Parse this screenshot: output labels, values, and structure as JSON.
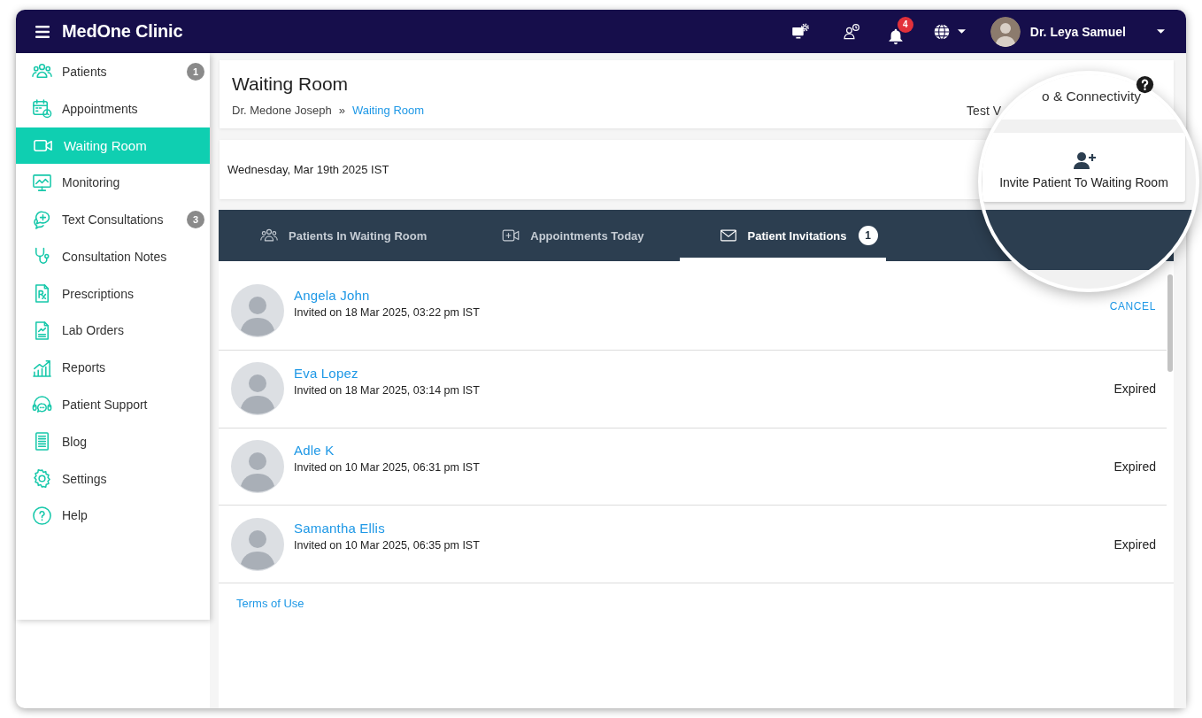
{
  "topbar": {
    "title": "MedOne Clinic",
    "notification_count": "4",
    "user_name": "Dr. Leya Samuel"
  },
  "sidebar": {
    "items": [
      {
        "label": "Patients",
        "badge": "1",
        "selected": false
      },
      {
        "label": "Appointments",
        "selected": false
      },
      {
        "label": "Waiting Room",
        "selected": true
      },
      {
        "label": "Monitoring",
        "selected": false
      },
      {
        "label": "Text Consultations",
        "badge": "3",
        "selected": false
      },
      {
        "label": "Consultation Notes",
        "selected": false
      },
      {
        "label": "Prescriptions",
        "selected": false
      },
      {
        "label": "Lab Orders",
        "selected": false
      },
      {
        "label": "Reports",
        "selected": false
      },
      {
        "label": "Patient Support",
        "selected": false
      },
      {
        "label": "Blog",
        "selected": false
      },
      {
        "label": "Settings",
        "selected": false
      },
      {
        "label": "Help",
        "selected": false
      }
    ]
  },
  "page_header": {
    "title": "Waiting Room",
    "breadcrumb": [
      {
        "label": "Dr. Medone Joseph",
        "kind": "text"
      },
      {
        "label": "Waiting Room",
        "kind": "link"
      }
    ],
    "breadcrumb_separator": "»",
    "test_link_fragment": "Test V"
  },
  "date_bar": {
    "date": "Wednesday, Mar 19th 2025 IST"
  },
  "tabs": [
    {
      "label": "Patients In Waiting Room",
      "selected": false
    },
    {
      "label": "Appointments Today",
      "selected": false
    },
    {
      "label": "Patient Invitations",
      "badge": "1",
      "selected": true
    }
  ],
  "invitations": [
    {
      "name": "Angela John",
      "invited": "Invited on 18 Mar 2025, 03:22 pm IST",
      "status": "CANCEL",
      "kind": "action"
    },
    {
      "name": "Eva Lopez",
      "invited": "Invited on 18 Mar 2025, 03:14 pm IST",
      "status": "Expired",
      "kind": "expired"
    },
    {
      "name": "Adle K",
      "invited": "Invited on 10 Mar 2025, 06:31 pm IST",
      "status": "Expired",
      "kind": "expired"
    },
    {
      "name": "Samantha Ellis",
      "invited": "Invited on 10 Mar 2025, 06:35 pm IST",
      "status": "Expired",
      "kind": "expired"
    }
  ],
  "footer": {
    "terms_link": "Terms of Use"
  },
  "magnifier": {
    "connectivity_fragment": "o & Connectivity",
    "invite_button": "Invite Patient To Waiting Room"
  }
}
